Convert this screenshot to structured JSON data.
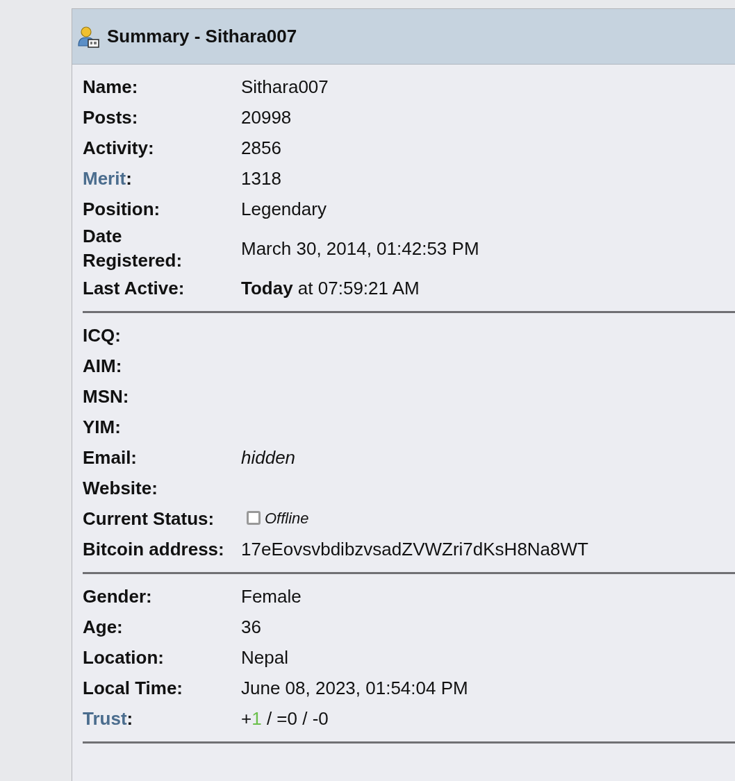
{
  "header": {
    "title": "Summary - Sithara007"
  },
  "sections": [
    {
      "rows": [
        {
          "label": "Name:",
          "value": "Sithara007"
        },
        {
          "label": "Posts:",
          "value": "20998"
        },
        {
          "label": "Activity:",
          "value": "2856"
        },
        {
          "label_link": "Merit",
          "label_rest": ":",
          "value": "1318"
        },
        {
          "label": "Position:",
          "value": "Legendary"
        },
        {
          "label": "Date\nRegistered:",
          "value": "March 30, 2014, 01:42:53 PM"
        },
        {
          "label": "Last Active:",
          "value": "**Today** at 07:59:21 AM"
        }
      ]
    },
    {
      "rows": [
        {
          "label": "ICQ:"
        },
        {
          "label": "AIM:"
        },
        {
          "label": "MSN:"
        },
        {
          "label": "YIM:"
        },
        {
          "label": "Email:",
          "value": "hidden",
          "italic": true
        },
        {
          "label": "Website:"
        },
        {
          "label": "Current Status:",
          "status": {
            "online": false,
            "text": "Offline"
          }
        },
        {
          "label": "Bitcoin address:",
          "value": "17eEovsvbdibzvsadZVWZri7dKsH8Na8WT"
        }
      ]
    },
    {
      "rows": [
        {
          "label": "Gender:",
          "value": "Female"
        },
        {
          "label": "Age:",
          "value": "36"
        },
        {
          "label": "Location:",
          "value": "Nepal"
        },
        {
          "label": "Local Time:",
          "value": "June 08, 2023, 01:54:04 PM"
        },
        {
          "label_link": "Trust",
          "label_rest": ":",
          "value_parts": [
            {
              "text": "+"
            },
            {
              "text": "1",
              "color": "#6abf4b"
            },
            {
              "text": " / =0 / -0"
            }
          ]
        }
      ]
    }
  ]
}
